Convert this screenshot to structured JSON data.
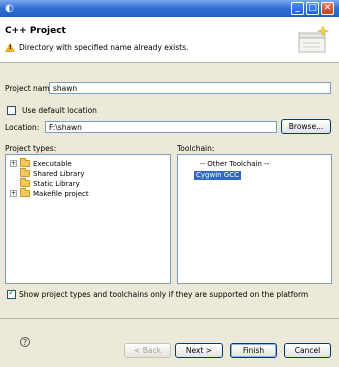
{
  "window": {
    "app_icon": "eclipse-icon"
  },
  "titlebar": {
    "min_glyph": "_",
    "max_glyph": "□",
    "close_glyph": "✕"
  },
  "header": {
    "title": "C++ Project",
    "warning": "Directory with specified name already exists."
  },
  "form": {
    "project_name_label": "Project name:",
    "project_name_value": "shawn",
    "use_default_location_label": "Use default location",
    "use_default_location_checked": false,
    "location_label": "Location:",
    "location_value": "F:\\shawn",
    "browse_label": "Browse..."
  },
  "project_types": {
    "label": "Project types:",
    "items": [
      {
        "label": "Executable",
        "expandable": true
      },
      {
        "label": "Shared Library",
        "expandable": false
      },
      {
        "label": "Static Library",
        "expandable": false
      },
      {
        "label": "Makefile project",
        "expandable": true
      }
    ]
  },
  "toolchain": {
    "label": "Toolchain:",
    "items": [
      {
        "label": "-- Other Toolchain --",
        "selected": false
      },
      {
        "label": "Cygwin GCC",
        "selected": true
      }
    ]
  },
  "filter": {
    "label": "Show project types and toolchains only if they are supported on the platform",
    "checked": true
  },
  "buttons": {
    "help_glyph": "?",
    "back": "< Back",
    "next": "Next >",
    "finish": "Finish",
    "cancel": "Cancel"
  }
}
